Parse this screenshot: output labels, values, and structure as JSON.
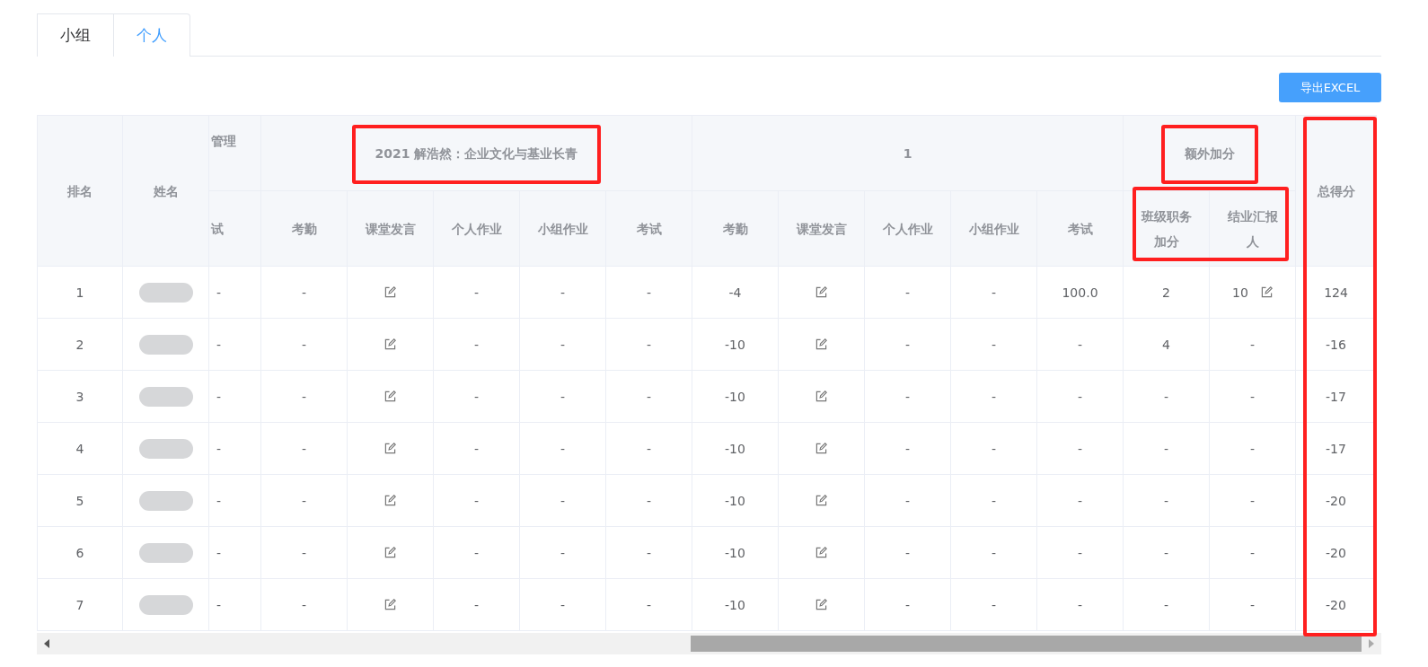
{
  "tabs": [
    {
      "label": "小组",
      "selected": false
    },
    {
      "label": "个人",
      "selected": true
    }
  ],
  "export_button": "导出EXCEL",
  "table": {
    "fixed_columns": [
      "排名",
      "姓名"
    ],
    "groups": [
      {
        "label": "管理",
        "highlighted": false,
        "children_highlighted": false,
        "children": [
          "试"
        ]
      },
      {
        "label": "2021 解浩然：企业文化与基业长青",
        "highlighted": true,
        "children_highlighted": false,
        "children": [
          "考勤",
          "课堂发言",
          "个人作业",
          "小组作业",
          "考试"
        ]
      },
      {
        "label": "1",
        "highlighted": false,
        "children_highlighted": false,
        "children": [
          "考勤",
          "课堂发言",
          "个人作业",
          "小组作业",
          "考试"
        ]
      },
      {
        "label": "额外加分",
        "highlighted": true,
        "children_highlighted": true,
        "children": [
          "班级职务加分",
          "结业汇报人"
        ]
      }
    ],
    "total": {
      "label": "总得分",
      "highlighted": true
    },
    "rows": [
      {
        "rank": "1",
        "cells": [
          {
            "kind": "text",
            "text": "-"
          },
          {
            "kind": "text",
            "text": "-"
          },
          {
            "kind": "edit"
          },
          {
            "kind": "text",
            "text": "-"
          },
          {
            "kind": "text",
            "text": "-"
          },
          {
            "kind": "text",
            "text": "-"
          },
          {
            "kind": "text",
            "text": "-4"
          },
          {
            "kind": "edit"
          },
          {
            "kind": "text",
            "text": "-"
          },
          {
            "kind": "text",
            "text": "-"
          },
          {
            "kind": "text",
            "text": "100.0"
          },
          {
            "kind": "text",
            "text": "2"
          },
          {
            "kind": "edit",
            "text": "10"
          }
        ],
        "total": "124"
      },
      {
        "rank": "2",
        "cells": [
          {
            "kind": "text",
            "text": "-"
          },
          {
            "kind": "text",
            "text": "-"
          },
          {
            "kind": "edit"
          },
          {
            "kind": "text",
            "text": "-"
          },
          {
            "kind": "text",
            "text": "-"
          },
          {
            "kind": "text",
            "text": "-"
          },
          {
            "kind": "text",
            "text": "-10"
          },
          {
            "kind": "edit"
          },
          {
            "kind": "text",
            "text": "-"
          },
          {
            "kind": "text",
            "text": "-"
          },
          {
            "kind": "text",
            "text": "-"
          },
          {
            "kind": "text",
            "text": "4"
          },
          {
            "kind": "text",
            "text": "-"
          }
        ],
        "total": "-16"
      },
      {
        "rank": "3",
        "cells": [
          {
            "kind": "text",
            "text": "-"
          },
          {
            "kind": "text",
            "text": "-"
          },
          {
            "kind": "edit"
          },
          {
            "kind": "text",
            "text": "-"
          },
          {
            "kind": "text",
            "text": "-"
          },
          {
            "kind": "text",
            "text": "-"
          },
          {
            "kind": "text",
            "text": "-10"
          },
          {
            "kind": "edit"
          },
          {
            "kind": "text",
            "text": "-"
          },
          {
            "kind": "text",
            "text": "-"
          },
          {
            "kind": "text",
            "text": "-"
          },
          {
            "kind": "text",
            "text": "-"
          },
          {
            "kind": "text",
            "text": "-"
          }
        ],
        "total": "-17"
      },
      {
        "rank": "4",
        "cells": [
          {
            "kind": "text",
            "text": "-"
          },
          {
            "kind": "text",
            "text": "-"
          },
          {
            "kind": "edit"
          },
          {
            "kind": "text",
            "text": "-"
          },
          {
            "kind": "text",
            "text": "-"
          },
          {
            "kind": "text",
            "text": "-"
          },
          {
            "kind": "text",
            "text": "-10"
          },
          {
            "kind": "edit"
          },
          {
            "kind": "text",
            "text": "-"
          },
          {
            "kind": "text",
            "text": "-"
          },
          {
            "kind": "text",
            "text": "-"
          },
          {
            "kind": "text",
            "text": "-"
          },
          {
            "kind": "text",
            "text": "-"
          }
        ],
        "total": "-17"
      },
      {
        "rank": "5",
        "cells": [
          {
            "kind": "text",
            "text": "-"
          },
          {
            "kind": "text",
            "text": "-"
          },
          {
            "kind": "edit"
          },
          {
            "kind": "text",
            "text": "-"
          },
          {
            "kind": "text",
            "text": "-"
          },
          {
            "kind": "text",
            "text": "-"
          },
          {
            "kind": "text",
            "text": "-10"
          },
          {
            "kind": "edit"
          },
          {
            "kind": "text",
            "text": "-"
          },
          {
            "kind": "text",
            "text": "-"
          },
          {
            "kind": "text",
            "text": "-"
          },
          {
            "kind": "text",
            "text": "-"
          },
          {
            "kind": "text",
            "text": "-"
          }
        ],
        "total": "-20"
      },
      {
        "rank": "6",
        "cells": [
          {
            "kind": "text",
            "text": "-"
          },
          {
            "kind": "text",
            "text": "-"
          },
          {
            "kind": "edit"
          },
          {
            "kind": "text",
            "text": "-"
          },
          {
            "kind": "text",
            "text": "-"
          },
          {
            "kind": "text",
            "text": "-"
          },
          {
            "kind": "text",
            "text": "-10"
          },
          {
            "kind": "edit"
          },
          {
            "kind": "text",
            "text": "-"
          },
          {
            "kind": "text",
            "text": "-"
          },
          {
            "kind": "text",
            "text": "-"
          },
          {
            "kind": "text",
            "text": "-"
          },
          {
            "kind": "text",
            "text": "-"
          }
        ],
        "total": "-20"
      },
      {
        "rank": "7",
        "cells": [
          {
            "kind": "text",
            "text": "-"
          },
          {
            "kind": "text",
            "text": "-"
          },
          {
            "kind": "edit"
          },
          {
            "kind": "text",
            "text": "-"
          },
          {
            "kind": "text",
            "text": "-"
          },
          {
            "kind": "text",
            "text": "-"
          },
          {
            "kind": "text",
            "text": "-10"
          },
          {
            "kind": "edit"
          },
          {
            "kind": "text",
            "text": "-"
          },
          {
            "kind": "text",
            "text": "-"
          },
          {
            "kind": "text",
            "text": "-"
          },
          {
            "kind": "text",
            "text": "-"
          },
          {
            "kind": "text",
            "text": "-"
          }
        ],
        "total": "-20"
      }
    ]
  }
}
